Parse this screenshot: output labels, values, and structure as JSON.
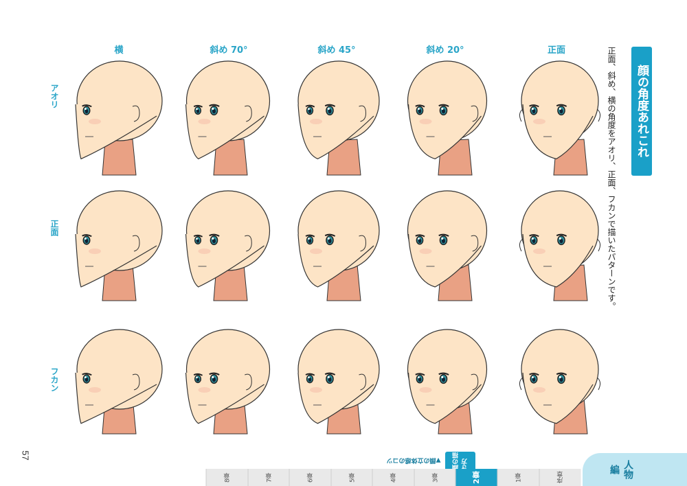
{
  "page": {
    "title": "顔の角度あれこれ",
    "subtitle": "正面、斜め、横の角度をアオリ、正面、フカンで描いたパターンです。",
    "page_number": "57"
  },
  "columns": [
    "横",
    "斜め 70°",
    "斜め 45°",
    "斜め 20°",
    "正面"
  ],
  "rows": [
    "アオリ",
    "正面",
    "フカン"
  ],
  "footer": {
    "section_label": "人物編",
    "chapter_sign": "顔の描き方",
    "chapter_number": "2章",
    "section_note": "▼顔の立体感のコツ",
    "tabs": [
      "序章",
      "1章",
      "2章",
      "3章",
      "4章",
      "5章",
      "6章",
      "7章",
      "8章"
    ]
  },
  "colors": {
    "accent": "#1aa0c8",
    "skin": "#fde4c6",
    "skin_shadow": "#e9a184",
    "eye": "#2f8f9a"
  }
}
